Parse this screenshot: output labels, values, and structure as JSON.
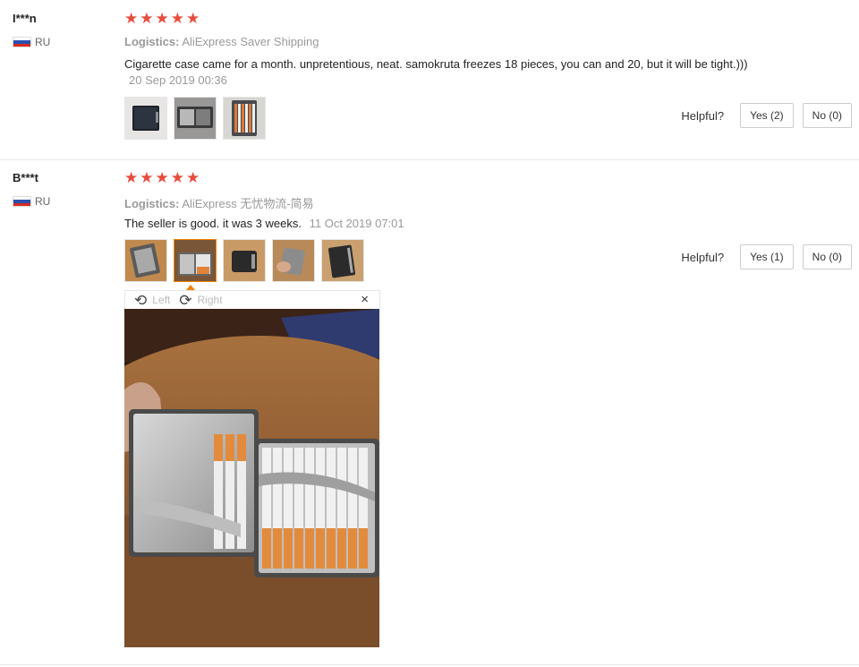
{
  "reviews": [
    {
      "user": "I***n",
      "country": "RU",
      "stars": 5,
      "logistics_label": "Logistics:",
      "logistics_value": "AliExpress Saver Shipping",
      "text": "Cigarette case came for a month. unpretentious, neat. samokruta freezes 18 pieces, you can and 20, but it will be tight.)))",
      "date": "20 Sep 2019 00:36",
      "photo_count": 3,
      "helpful_label": "Helpful?",
      "yes_label": "Yes (2)",
      "no_label": "No (0)"
    },
    {
      "user": "B***t",
      "country": "RU",
      "stars": 5,
      "logistics_label": "Logistics:",
      "logistics_value": "AliExpress 无忧物流-简易",
      "text": "The seller is good. it was 3 weeks.",
      "date": "11 Oct 2019 07:01",
      "photo_count": 5,
      "selected_photo": 2,
      "helpful_label": "Helpful?",
      "yes_label": "Yes (1)",
      "no_label": "No (0)"
    }
  ],
  "viewer": {
    "rotate_left_label": "Left",
    "rotate_right_label": "Right",
    "close_symbol": "×"
  },
  "colors": {
    "star": "#e74c3c",
    "active_thumb": "#f08200",
    "muted_text": "#999999"
  }
}
